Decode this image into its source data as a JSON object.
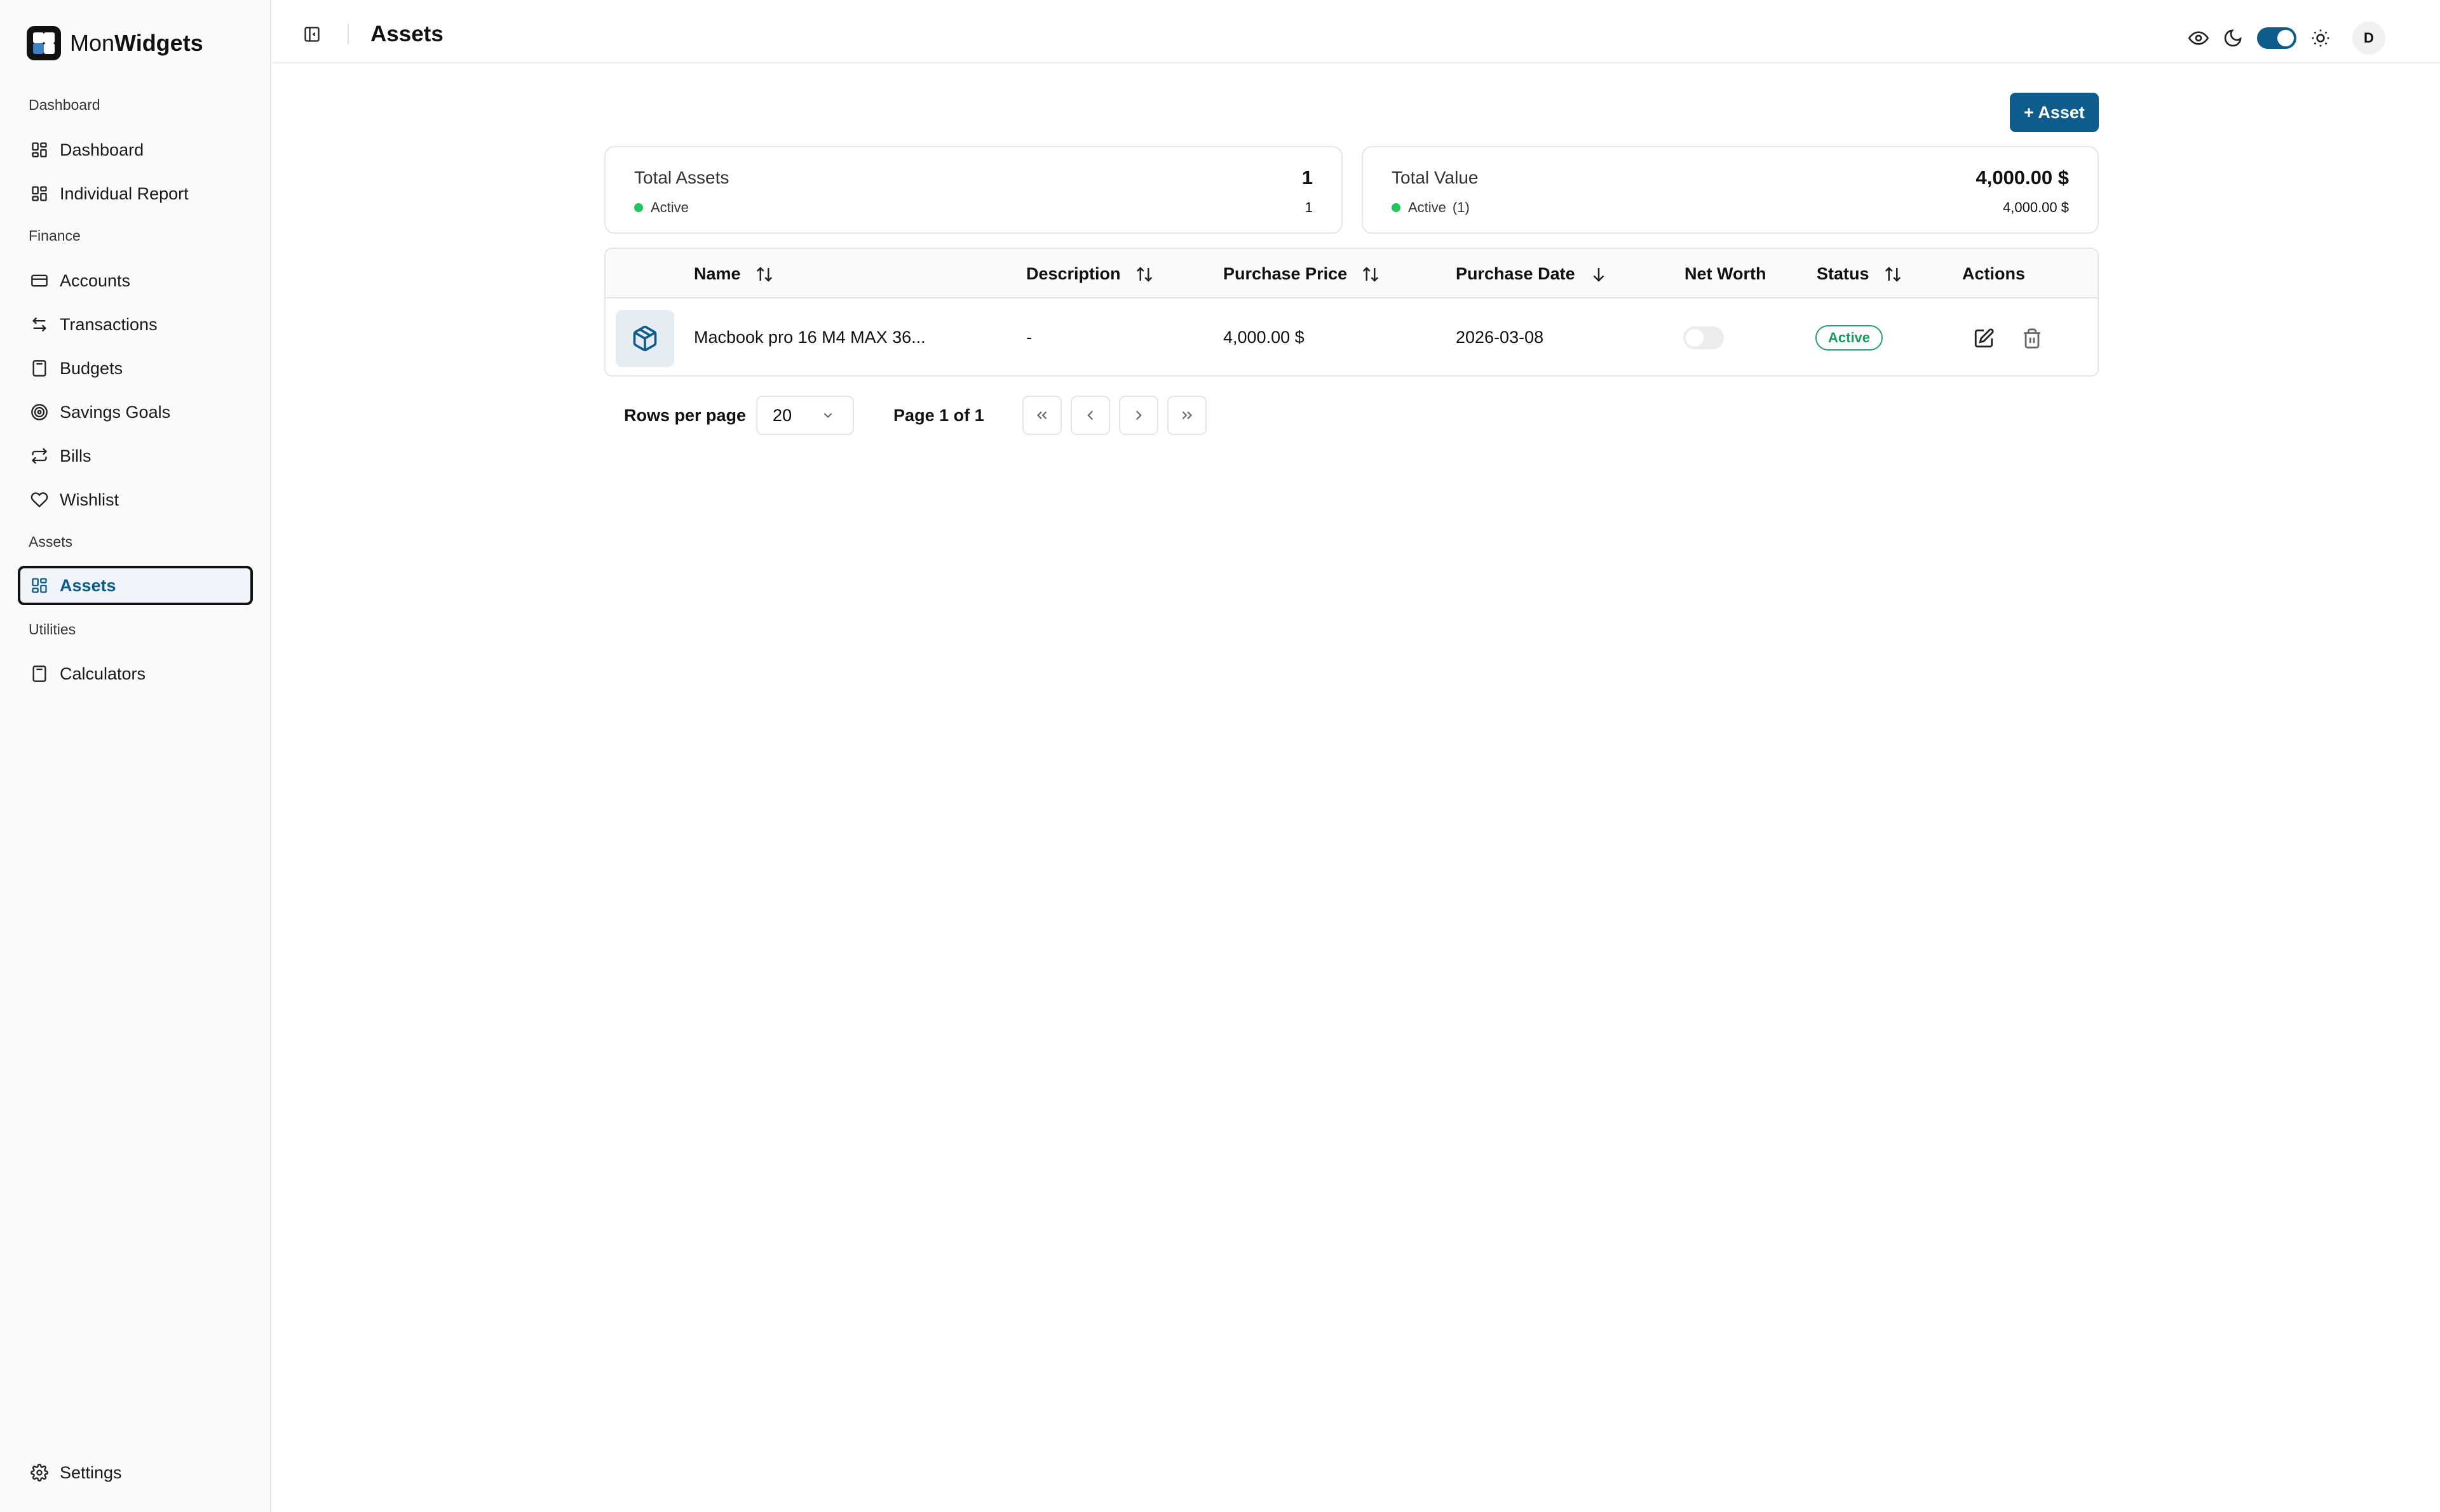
{
  "brand": {
    "name_prefix": "Mon",
    "name_suffix": "Widgets"
  },
  "sidebar": {
    "groups": [
      {
        "label": "Dashboard",
        "items": [
          {
            "label": "Dashboard",
            "icon": "layout-grid-icon"
          },
          {
            "label": "Individual Report",
            "icon": "layout-grid-icon"
          }
        ]
      },
      {
        "label": "Finance",
        "items": [
          {
            "label": "Accounts",
            "icon": "wallet-icon"
          },
          {
            "label": "Transactions",
            "icon": "arrows-left-right-icon"
          },
          {
            "label": "Budgets",
            "icon": "calculator-icon"
          },
          {
            "label": "Savings Goals",
            "icon": "target-icon"
          },
          {
            "label": "Bills",
            "icon": "repeat-icon"
          },
          {
            "label": "Wishlist",
            "icon": "heart-icon"
          }
        ]
      },
      {
        "label": "Assets",
        "items": [
          {
            "label": "Assets",
            "icon": "layout-grid-icon",
            "active": true
          }
        ]
      },
      {
        "label": "Utilities",
        "items": [
          {
            "label": "Calculators",
            "icon": "calculator-icon"
          }
        ]
      }
    ],
    "settings_label": "Settings"
  },
  "header": {
    "title": "Assets",
    "avatar_initial": "D"
  },
  "actions": {
    "add_asset_label": "+ Asset"
  },
  "summary": {
    "total_assets": {
      "title": "Total Assets",
      "value": "1",
      "status_label": "Active",
      "status_value": "1"
    },
    "total_value": {
      "title": "Total Value",
      "value": "4,000.00 $",
      "status_label": "Active",
      "status_count": "(1)",
      "status_value": "4,000.00 $"
    }
  },
  "table": {
    "columns": [
      "Name",
      "Description",
      "Purchase Price",
      "Purchase Date",
      "Net Worth",
      "Status",
      "Actions"
    ],
    "rows": [
      {
        "name": "Macbook pro 16 M4 MAX 36...",
        "description": "-",
        "purchase_price": "4,000.00 $",
        "purchase_date": "2026-03-08",
        "net_worth": false,
        "status": "Active"
      }
    ]
  },
  "pagination": {
    "rows_per_page_label": "Rows per page",
    "rows_per_page": "20",
    "page_info": "Page 1 of 1"
  },
  "colors": {
    "brand": "#0e5c8c",
    "active_status": "#22a06b",
    "status_dot": "#22c55e"
  }
}
